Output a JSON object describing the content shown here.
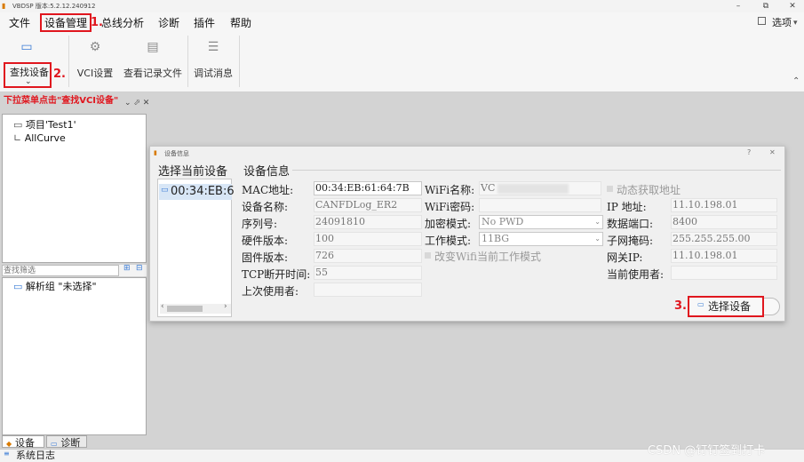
{
  "window": {
    "title": "VBDSP 版本:5.2.12.240912",
    "minimize": "–",
    "restore": "⧉",
    "close": "✕",
    "minimize_ribbon": "⌃"
  },
  "menu": {
    "items": [
      "文件",
      "设备管理",
      "总线分析",
      "诊断",
      "插件",
      "帮助"
    ],
    "options": "选项",
    "options_arrow": "▾"
  },
  "annotations": {
    "step1": "1.",
    "step2": "2.",
    "step2_note": "下拉菜单点击\"查找VCI设备\"",
    "step3": "3."
  },
  "ribbon": {
    "find_device": "查找设备",
    "find_device_arrow": "⌄",
    "vci_settings": "VCI设置",
    "view_log_files": "查看记录文件",
    "debug_messages": "调试消息"
  },
  "project_panel": {
    "controls": "⌄ ⬀ ✕",
    "items": [
      "项目'Test1'",
      "AllCurve"
    ]
  },
  "filter_panel": {
    "filter_placeholder": "查找筛选",
    "items": [
      "解析组 \"未选择\""
    ]
  },
  "bottom_tabs": {
    "device": "设备",
    "diagnostics": "诊断",
    "system_log": "系统日志"
  },
  "dialog": {
    "title": "设备信息",
    "help": "?",
    "close": "✕",
    "select_current_device_heading": "选择当前设备",
    "device_list": [
      "00:34:EB:6"
    ],
    "scroll_left": "‹",
    "scroll_right": "›",
    "device_info_heading": "设备信息",
    "fields": {
      "mac_label": "MAC地址:",
      "mac_value": "00:34:EB:61:64:7B",
      "device_name_label": "设备名称:",
      "device_name_value": "CANFDLog_ER2",
      "serial_label": "序列号:",
      "serial_value": "24091810",
      "hw_version_label": "硬件版本:",
      "hw_version_value": "100",
      "fw_version_label": "固件版本:",
      "fw_version_value": "726",
      "tcp_timeout_label": "TCP断开时间:",
      "tcp_timeout_value": "55",
      "last_user_label": "上次使用者:",
      "last_user_value": "",
      "wifi_name_label": "WiFi名称:",
      "wifi_name_value": "VC",
      "wifi_password_label": "WiFi密码:",
      "wifi_password_value": "",
      "encryption_label": "加密模式:",
      "encryption_value": "No PWD",
      "work_mode_label": "工作模式:",
      "work_mode_value": "11BG",
      "change_wifi_mode": "改变Wifi当前工作模式",
      "dhcp_label": "动态获取地址",
      "ip_label": "IP 地址:",
      "ip_value": "11.10.198.01",
      "port_label": "数据端口:",
      "port_value": "8400",
      "mask_label": "子网掩码:",
      "mask_value": "255.255.255.00",
      "gateway_label": "网关IP:",
      "gateway_value": "11.10.198.01",
      "current_user_label": "当前使用者:",
      "current_user_value": ""
    },
    "select_device_button": "选择设备"
  },
  "watermark": "CSDN @钉钉签到打卡",
  "colors": {
    "annotation_red": "#e0161e",
    "workspace_bg": "#d3d3d3"
  }
}
